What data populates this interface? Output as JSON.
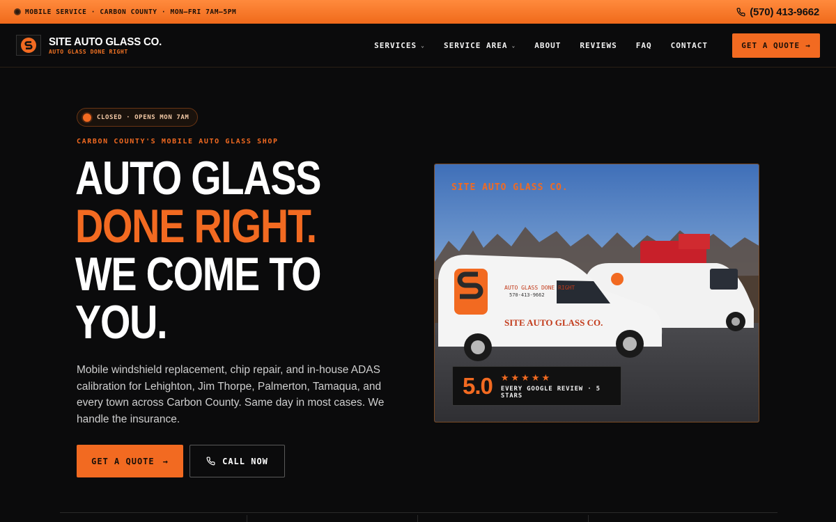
{
  "topbar": {
    "notice": "MOBILE SERVICE · CARBON COUNTY · MON–FRI 7AM–5PM",
    "phone": "(570) 413-9662"
  },
  "brand": {
    "name": "SITE AUTO GLASS CO.",
    "tagline": "AUTO GLASS DONE RIGHT"
  },
  "nav": {
    "items": [
      {
        "label": "SERVICES",
        "dropdown": true
      },
      {
        "label": "SERVICE AREA",
        "dropdown": true
      },
      {
        "label": "ABOUT",
        "dropdown": false
      },
      {
        "label": "REVIEWS",
        "dropdown": false
      },
      {
        "label": "FAQ",
        "dropdown": false
      },
      {
        "label": "CONTACT",
        "dropdown": false
      }
    ],
    "cta": "GET A QUOTE"
  },
  "hero": {
    "status": "CLOSED · OPENS MON 7AM",
    "eyebrow": "CARBON COUNTY'S MOBILE AUTO GLASS SHOP",
    "headline_1": "AUTO GLASS",
    "headline_2": "DONE RIGHT.",
    "headline_3": "WE COME TO YOU.",
    "lead": "Mobile windshield replacement, chip repair, and in-house ADAS calibration for Lehighton, Jim Thorpe, Palmerton, Tamaqua, and every town across Carbon County. Same day in most cases. We handle the insurance.",
    "primary_button": "GET A QUOTE",
    "secondary_button": "CALL NOW"
  },
  "photo": {
    "label": "SITE AUTO GLASS CO.",
    "van_text_1": "AUTO GLASS DONE RIGHT",
    "van_text_2": "570-413-9662",
    "van_brand": "SITE AUTO GLASS CO.",
    "rating": "5.0",
    "stars": 5,
    "rating_text": "EVERY GOOGLE REVIEW · 5 STARS"
  },
  "colors": {
    "accent": "#f26a21",
    "background": "#0b0b0c"
  }
}
